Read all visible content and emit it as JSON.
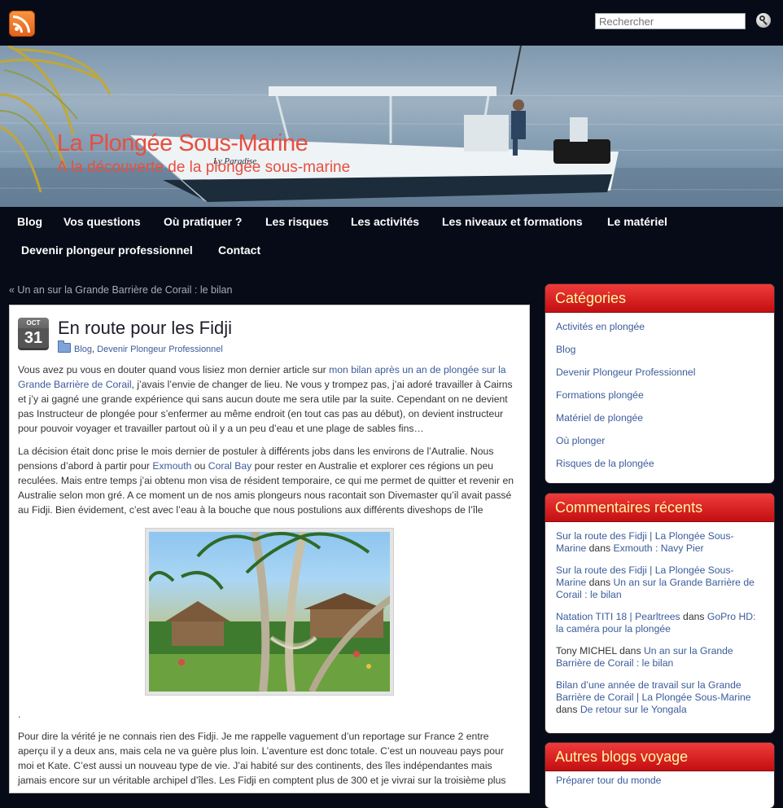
{
  "top": {
    "rss_icon": "rss-icon",
    "search_placeholder": "Rechercher",
    "search_icon": "magnifier-icon"
  },
  "header": {
    "title": "La Plongée Sous-Marine",
    "description": "A la découverte de la plongée sous-marine",
    "boat_name": "Ly Paradise"
  },
  "nav": {
    "items": [
      {
        "label": "Blog"
      },
      {
        "label": "Vos questions"
      },
      {
        "label": "Où pratiquer ?"
      },
      {
        "label": "Les risques"
      },
      {
        "label": "Les activités"
      },
      {
        "label": "Les niveaux et formations"
      },
      {
        "label": "Le matériel"
      },
      {
        "label": "Devenir plongeur professionnel"
      },
      {
        "label": "Contact"
      }
    ]
  },
  "main": {
    "prev_post": "« Un an sur la Grande Barrière de Corail : le bilan",
    "post": {
      "date_month": "OCT",
      "date_day": "31",
      "title": "En route pour les Fidji",
      "cat1": "Blog",
      "cat_sep": ", ",
      "cat2": "Devenir Plongeur Professionnel",
      "p1a": "Vous avez pu vous en douter quand vous lisiez mon dernier article sur ",
      "p1_link": "mon bilan après un an de plongée sur la Grande Barrière de Corail",
      "p1b": ", j’avais l’envie de changer de lieu. Ne vous y trompez pas, j’ai adoré travailler à Cairns et j’y ai gagné une grande expérience qui sans aucun doute me sera utile par la suite. Cependant on ne devient pas Instructeur de plongée pour s’enfermer au même endroit (en tout cas pas au début), on devient instructeur pour pouvoir voyager et travailler partout où il y a un peu d’eau et une plage de sables fins…",
      "p2a": "La décision était donc prise le mois dernier de postuler à différents jobs dans les environs de l’Autralie. Nous pensions d’abord à partir pour ",
      "p2_link1": "Exmouth",
      "p2b": " ou ",
      "p2_link2": "Coral Bay",
      "p2c": " pour rester en Australie et explorer ces régions un peu reculées. Mais entre temps j’ai obtenu mon visa de résident temporaire, ce qui me permet de quitter et revenir en Australie selon mon gré. A ce moment un de nos amis plongeurs nous racontait son Divemaster qu’il avait passé au Fidji. Bien évidement, c’est avec l’eau à la bouche que nous postulions aux différents diveshops de l’île",
      "dot": ".",
      "p3": "Pour dire la vérité je ne connais rien des Fidji. Je me rappelle vaguement d’un reportage sur France 2 entre aperçu il y a deux ans, mais cela ne va guère plus loin. L’aventure est donc totale. C’est un nouveau pays pour moi et Kate. C’est aussi un nouveau type de vie. J’ai habité sur des continents, des îles indépendantes mais jamais encore sur un véritable archipel d’îles. Les Fidji en comptent plus de 300 et je vivrai sur la troisième plus"
    }
  },
  "sidebar": {
    "categories": {
      "title": "Catégories",
      "items": [
        "Activités en plongée",
        "Blog",
        "Devenir Plongeur Professionnel",
        "Formations plongée",
        "Matériel de plongée",
        "Où plonger",
        "Risques de la plongée"
      ]
    },
    "comments": {
      "title": "Commentaires récents",
      "items": [
        {
          "author": "Sur la route des Fidji | La Plongée Sous-Marine",
          "on": " dans ",
          "post": "Exmouth : Navy Pier"
        },
        {
          "author": "Sur la route des Fidji | La Plongée Sous-Marine",
          "on": " dans ",
          "post": "Un an sur la Grande Barrière de Corail : le bilan"
        },
        {
          "author": "Natation TITI 18 | Pearltrees",
          "on": " dans ",
          "post": "GoPro HD: la caméra pour la plongée"
        },
        {
          "author": "Tony MICHEL",
          "on": " dans ",
          "post": "Un an sur la Grande Barrière de Corail : le bilan"
        },
        {
          "author": "Bilan d’une année de travail sur la Grande Barrière de Corail | La Plongée Sous-Marine",
          "on": " dans ",
          "post": "De retour sur le Yongala"
        }
      ]
    },
    "blogs": {
      "title": "Autres blogs voyage",
      "items": [
        "Préparer tour du monde"
      ]
    }
  },
  "colors": {
    "page_bg": "#070b17",
    "link": "#3b5b9b",
    "widget_header": "#d9191b",
    "widget_title_text": "#fff7a0",
    "site_title": "#e84f3f"
  }
}
